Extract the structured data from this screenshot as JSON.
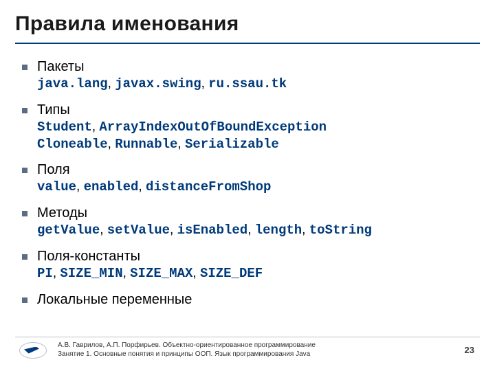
{
  "title": "Правила именования",
  "items": [
    {
      "label": "Пакеты",
      "code_lines": [
        [
          {
            "t": "java.lang",
            "c": true
          },
          {
            "t": ", ",
            "c": false
          },
          {
            "t": "javax.swing",
            "c": true
          },
          {
            "t": ", ",
            "c": false
          },
          {
            "t": "ru.ssau.tk",
            "c": true
          }
        ]
      ]
    },
    {
      "label": "Типы",
      "code_lines": [
        [
          {
            "t": "Student",
            "c": true
          },
          {
            "t": ", ",
            "c": false
          },
          {
            "t": "ArrayIndexOutOfBoundException",
            "c": true
          }
        ],
        [
          {
            "t": "Cloneable",
            "c": true
          },
          {
            "t": ", ",
            "c": false
          },
          {
            "t": "Runnable",
            "c": true
          },
          {
            "t": ", ",
            "c": false
          },
          {
            "t": "Serializable",
            "c": true
          }
        ]
      ]
    },
    {
      "label": "Поля",
      "code_lines": [
        [
          {
            "t": "value",
            "c": true
          },
          {
            "t": ", ",
            "c": false
          },
          {
            "t": "enabled",
            "c": true
          },
          {
            "t": ", ",
            "c": false
          },
          {
            "t": "distanceFromShop",
            "c": true
          }
        ]
      ]
    },
    {
      "label": "Методы",
      "code_lines": [
        [
          {
            "t": "getValue",
            "c": true
          },
          {
            "t": ", ",
            "c": false
          },
          {
            "t": "setValue",
            "c": true
          },
          {
            "t": ", ",
            "c": false
          },
          {
            "t": "isEnabled",
            "c": true
          },
          {
            "t": ", ",
            "c": false
          },
          {
            "t": "length",
            "c": true
          },
          {
            "t": ", ",
            "c": false
          },
          {
            "t": "toString",
            "c": true
          }
        ]
      ]
    },
    {
      "label": "Поля-константы",
      "code_lines": [
        [
          {
            "t": "PI",
            "c": true
          },
          {
            "t": ", ",
            "c": false
          },
          {
            "t": "SIZE_MIN",
            "c": true
          },
          {
            "t": ", ",
            "c": false
          },
          {
            "t": "SIZE_MAX",
            "c": true
          },
          {
            "t": ", ",
            "c": false
          },
          {
            "t": "SIZE_DEF",
            "c": true
          }
        ]
      ]
    },
    {
      "label": "Локальные переменные",
      "code_lines": []
    }
  ],
  "footer": {
    "line1": "А.В. Гаврилов, А.П. Порфирьев. Объектно-ориентированное программирование",
    "line2": "Занятие 1. Основные понятия и принципы ООП. Язык программирования Java",
    "page": "23"
  }
}
